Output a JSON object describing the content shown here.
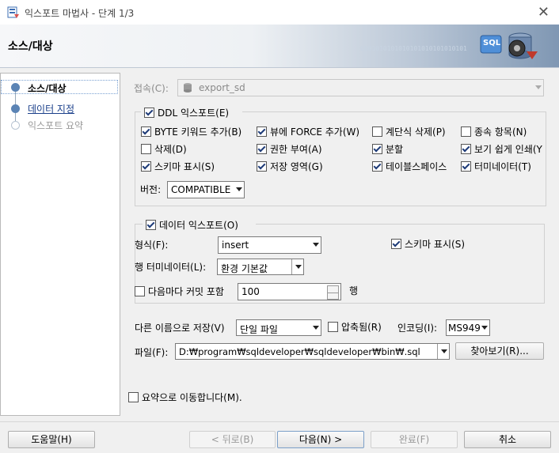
{
  "window": {
    "title": "익스포트 마법사 - 단계 1/3",
    "close_glyph": "✕"
  },
  "banner": {
    "heading": "소스/대상",
    "binary": "0001010101010101010101010101",
    "badge": "SQL"
  },
  "steps": [
    {
      "label": "소스/대상",
      "state": "active"
    },
    {
      "label": "데이터 지정",
      "state": "link"
    },
    {
      "label": "익스포트 요약",
      "state": "disabled"
    }
  ],
  "connection": {
    "label": "접속(C):",
    "value": "export_sd"
  },
  "ddl": {
    "group_label": "DDL 익스포트(E)",
    "checked": true,
    "options": [
      {
        "label": "BYTE 키워드 추가(B)",
        "checked": true
      },
      {
        "label": "뷰에 FORCE 추가(W)",
        "checked": true
      },
      {
        "label": "계단식 삭제(P)",
        "checked": false
      },
      {
        "label": "종속 항목(N)",
        "checked": false
      },
      {
        "label": "삭제(D)",
        "checked": false
      },
      {
        "label": "권한 부여(A)",
        "checked": true
      },
      {
        "label": "분할",
        "checked": true
      },
      {
        "label": "보기 쉽게 인쇄(Y",
        "checked": true
      },
      {
        "label": "스키마 표시(S)",
        "checked": true
      },
      {
        "label": "저장 영역(G)",
        "checked": true
      },
      {
        "label": "테이블스페이스",
        "checked": true
      },
      {
        "label": "터미네이터(T)",
        "checked": true
      }
    ],
    "version_label": "버전:",
    "version_value": "COMPATIBLE"
  },
  "data": {
    "group_label": "데이터 익스포트(O)",
    "checked": true,
    "format_label": "형식(F):",
    "format_value": "insert",
    "show_schema_label": "스키마 표시(S)",
    "show_schema_checked": true,
    "terminator_label": "행 터미네이터(L):",
    "terminator_value": "환경 기본값",
    "commit_label": "다음마다 커밋 포함",
    "commit_checked": false,
    "commit_value": "100",
    "commit_unit": "행"
  },
  "save": {
    "save_as_label": "다른 이름으로 저장(V)",
    "save_as_value": "단일 파일",
    "compress_label": "압축됨(R)",
    "compress_checked": false,
    "encoding_label": "인코딩(I):",
    "encoding_value": "MS949",
    "file_label": "파일(F):",
    "file_value": "D:₩program₩sqldeveloper₩sqldeveloper₩bin₩.sql",
    "browse_label": "찾아보기(R)..."
  },
  "summary_jump": {
    "label": "요약으로 이동합니다(M).",
    "checked": false
  },
  "buttons": {
    "help": "도움말(H)",
    "back": "< 뒤로(B)",
    "next": "다음(N) >",
    "finish": "완료(F)",
    "cancel": "취소"
  }
}
